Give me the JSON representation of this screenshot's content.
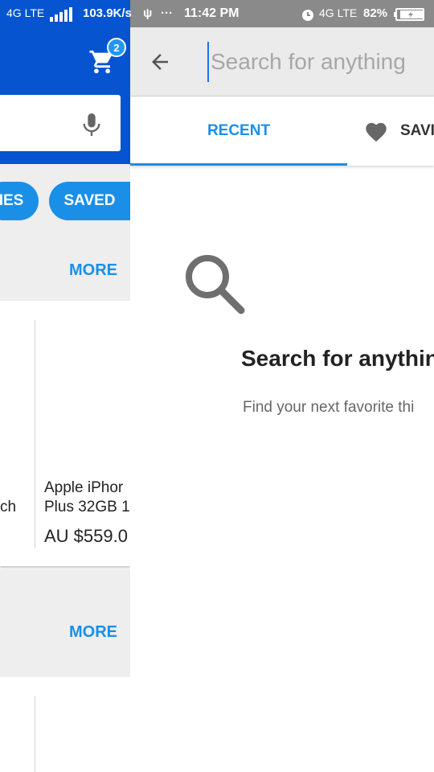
{
  "status_bar": {
    "network_left": "4G LTE",
    "speed": "103.9K/s",
    "time": "11:42 PM",
    "network_right": "4G LTE",
    "battery": "82%"
  },
  "background": {
    "cart_badge": "2",
    "chip_categories_partial": "IES",
    "chip_saved": "SAVED",
    "more_1": "MORE",
    "more_2": "MORE",
    "product_left_partial": "ch",
    "product_title_line1": "Apple iPhor",
    "product_title_line2": "Plus 32GB 1",
    "product_price": "AU $559.0"
  },
  "search": {
    "placeholder": "Search for anything",
    "tabs": {
      "recent": "RECENT",
      "saved": "SAVI"
    },
    "empty_state": {
      "title": "Search for anythin",
      "subtitle": "Find your next favorite thi"
    }
  },
  "colors": {
    "ebay_blue": "#0654cf",
    "accent": "#1a8fe8"
  }
}
